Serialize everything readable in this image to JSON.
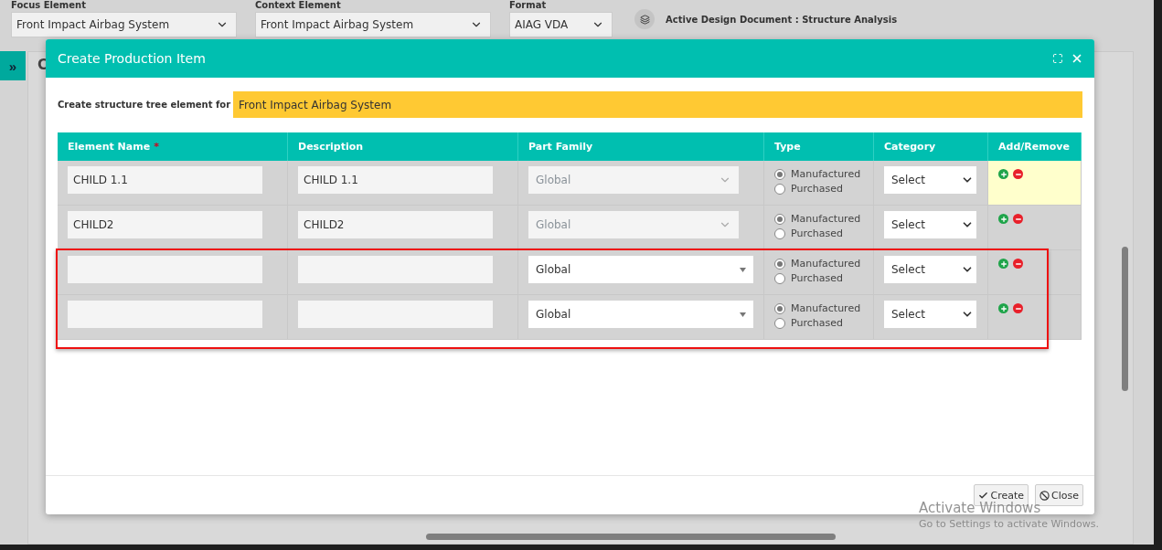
{
  "top_bar": {
    "fields": [
      {
        "label": "Focus Element",
        "value": "Front Impact Airbag System"
      },
      {
        "label": "Context Element",
        "value": "Front Impact Airbag System"
      },
      {
        "label": "Format",
        "value": "AIAG VDA"
      }
    ],
    "active_document": "Active Design Document : Structure Analysis"
  },
  "sidebar_toggle": "»",
  "background_panel": {
    "tab_label": "C"
  },
  "dialog": {
    "title": "Create Production Item",
    "target": {
      "label": "Create structure tree element for",
      "value": "Front Impact Airbag System"
    },
    "table": {
      "columns": [
        {
          "label": "Element Name",
          "required_mark": "*"
        },
        {
          "label": "Description"
        },
        {
          "label": "Part Family"
        },
        {
          "label": "Type"
        },
        {
          "label": "Category"
        },
        {
          "label": "Add/Remove"
        }
      ],
      "rows": [
        {
          "name": "CHILD 1.1",
          "description": "CHILD 1.1",
          "part_family": "Global",
          "part_family_disabled": true,
          "types": [
            {
              "label": "Manufactured",
              "selected": true
            },
            {
              "label": "Purchased",
              "selected": false
            }
          ],
          "category": "Select",
          "highlighted": true
        },
        {
          "name": "CHILD2",
          "description": "CHILD2",
          "part_family": "Global",
          "part_family_disabled": true,
          "types": [
            {
              "label": "Manufactured",
              "selected": true
            },
            {
              "label": "Purchased",
              "selected": false
            }
          ],
          "category": "Select",
          "highlighted": false
        },
        {
          "part_family": "Global",
          "part_family_disabled": false,
          "types": [
            {
              "label": "Manufactured",
              "selected": true
            },
            {
              "label": "Purchased",
              "selected": false
            }
          ],
          "category": "Select",
          "highlighted": false
        },
        {
          "part_family": "Global",
          "part_family_disabled": false,
          "types": [
            {
              "label": "Manufactured",
              "selected": true
            },
            {
              "label": "Purchased",
              "selected": false
            }
          ],
          "category": "Select",
          "highlighted": false
        }
      ]
    },
    "buttons": [
      {
        "kind": "create",
        "label": "Create"
      },
      {
        "kind": "close",
        "label": "Close"
      }
    ]
  },
  "os_notice": {
    "title": "Activate Windows",
    "subtitle": "Go to Settings to activate Windows."
  }
}
